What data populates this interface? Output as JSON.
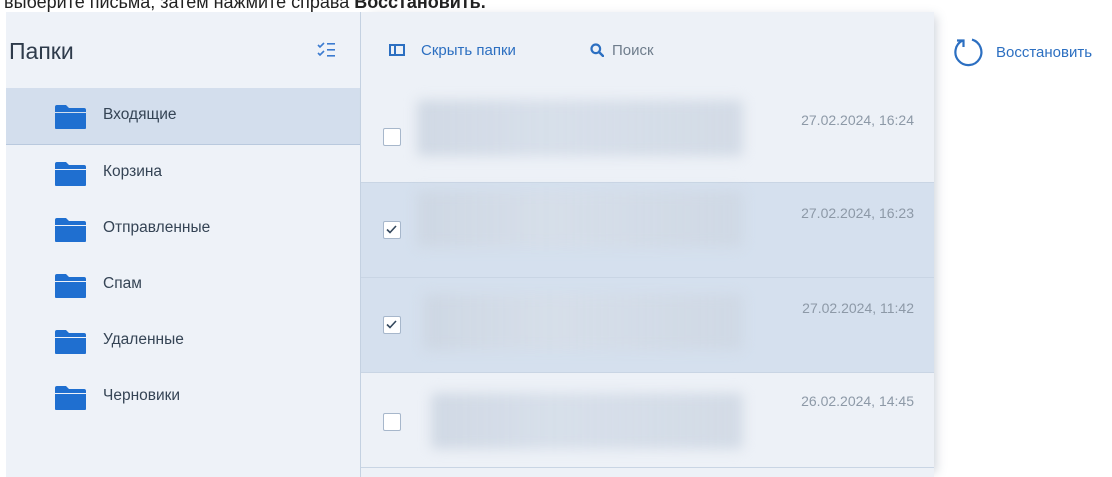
{
  "caption": {
    "prefix": "выберите письма, затем нажмите справа ",
    "action": "Восстановить."
  },
  "sidebar": {
    "title": "Папки",
    "sort_icon": "sort-list-icon",
    "folders": [
      {
        "label": "Входящие",
        "selected": true
      },
      {
        "label": "Корзина",
        "selected": false
      },
      {
        "label": "Отправленные",
        "selected": false
      },
      {
        "label": "Спам",
        "selected": false
      },
      {
        "label": "Удаленные",
        "selected": false
      },
      {
        "label": "Черновики",
        "selected": false
      }
    ]
  },
  "toolbar": {
    "hide_folders_label": "Скрыть папки",
    "search_label": "Поиск"
  },
  "messages": [
    {
      "date": "27.02.2024, 16:24",
      "checked": false
    },
    {
      "date": "27.02.2024, 16:23",
      "checked": true
    },
    {
      "date": "27.02.2024, 11:42",
      "checked": true
    },
    {
      "date": "26.02.2024, 14:45",
      "checked": false
    }
  ],
  "actions": {
    "restore_label": "Восстановить"
  },
  "colors": {
    "accent": "#2c6fc1",
    "folder": "#1f6fd0",
    "selected_bg": "#d3deed"
  }
}
